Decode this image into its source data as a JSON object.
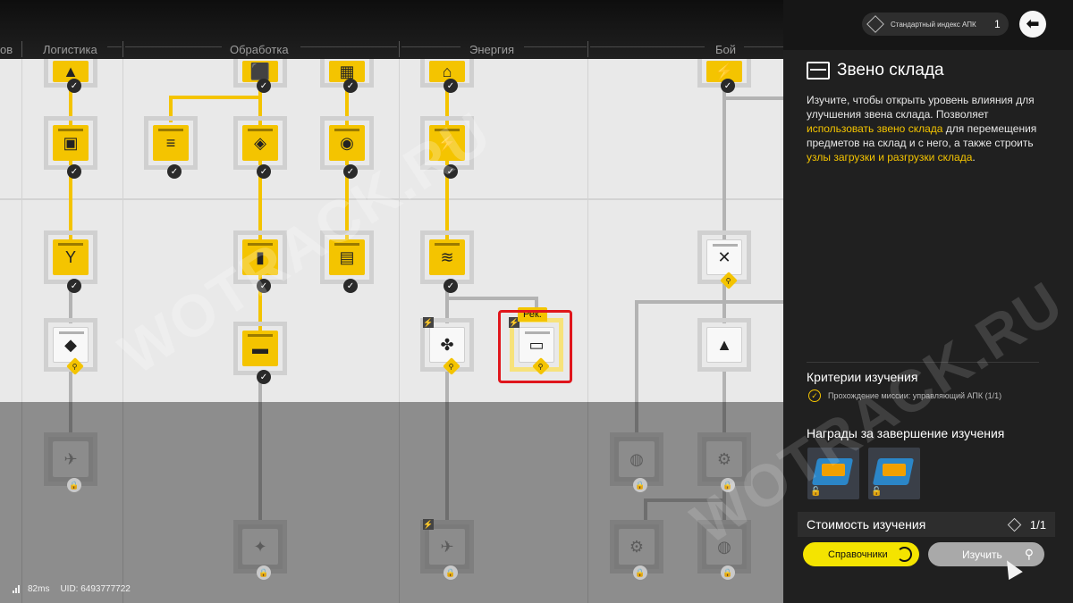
{
  "tree": {
    "categories": [
      "ов",
      "Логистика",
      "Обработка",
      "Энергия",
      "Бой"
    ],
    "recommend_tag": "Рек.",
    "glyphs": {
      "r0": [
        "▲",
        "⬛",
        "▦",
        "⌂",
        "⚡"
      ],
      "r1": [
        "▣",
        "≡",
        "◈",
        "◉",
        "⚡"
      ],
      "r2": [
        "Y",
        "▮",
        "▤",
        "≋",
        "✕"
      ],
      "r3": [
        "◆",
        "▬",
        "✤",
        "▭",
        "▲"
      ],
      "locked": [
        "✈",
        "◍",
        "⚙",
        "✦"
      ]
    }
  },
  "watermark": [
    "WOTRACK.RU",
    "WOTRACK.RU",
    "WOTRACK.RU"
  ],
  "status": {
    "ping": "82ms",
    "uid": "UID: 6493777722"
  },
  "panel": {
    "currency": {
      "label": "Стандартный индекс АПК",
      "value": "1"
    },
    "back_icon": "arrow-left-icon",
    "title": "Звено склада",
    "desc": {
      "p1": "Изучите, чтобы открыть уровень влияния для улучшения звена склада. Позволяет ",
      "h1": "использовать звено склада",
      "p2": " для перемещения предметов на склад и с него, а также строить ",
      "h2": "узлы загрузки и разгрузки склада",
      "p3": "."
    },
    "criteria_title": "Критерии изучения",
    "criteria_item": "Прохождение миссии: управляющий АПК (1/1)",
    "rewards_title": "Награды за завершение изучения",
    "cost_label": "Стоимость изучения",
    "cost_value": "1/1",
    "btn_reference": "Справочники",
    "btn_study": "Изучить"
  },
  "colors": {
    "accent": "#f4c400",
    "select": "#e0161c",
    "panel_bg": "#202020"
  }
}
